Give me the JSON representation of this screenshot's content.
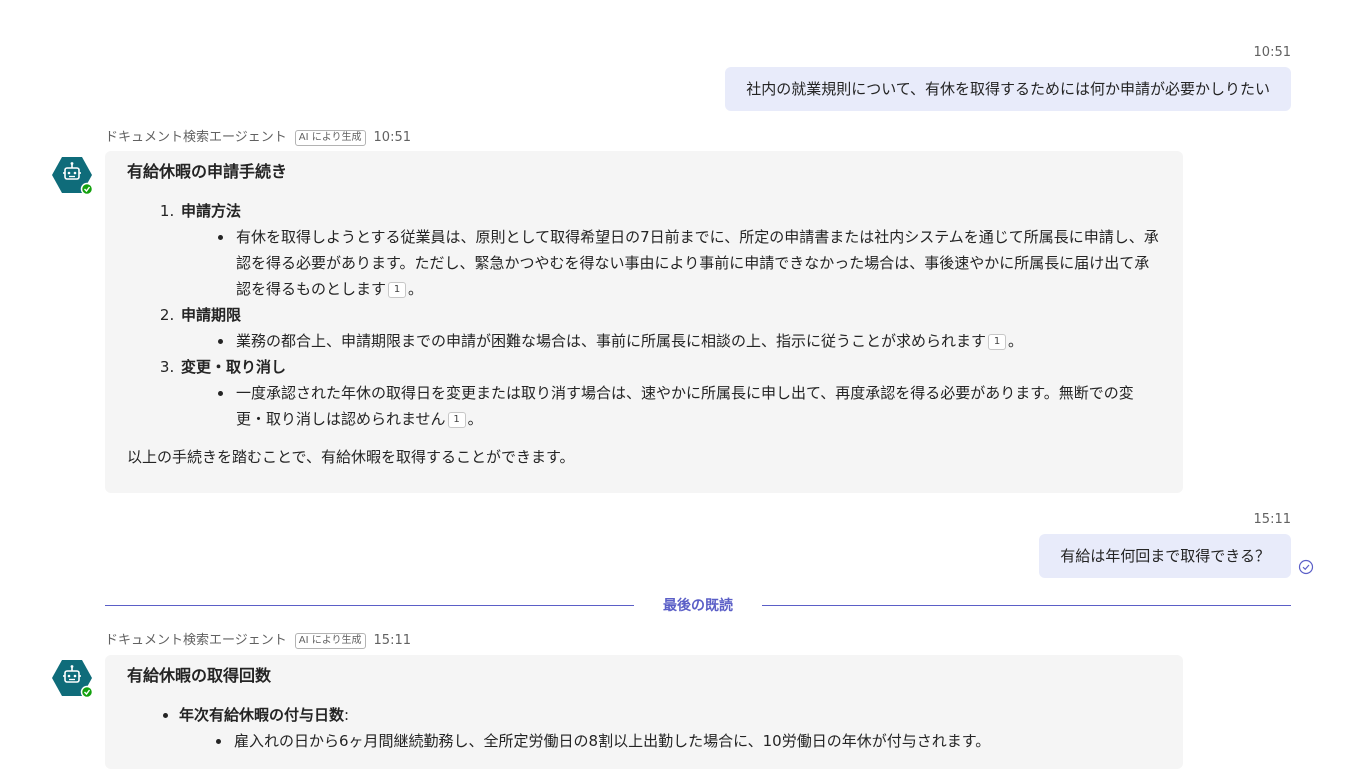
{
  "messages": {
    "m1": {
      "time": "10:51",
      "text": "社内の就業規則について、有休を取得するためには何か申請が必要かしりたい"
    },
    "r1": {
      "sender": "ドキュメント検索エージェント",
      "badge": "AI により生成",
      "time": "10:51",
      "title": "有給休暇の申請手続き",
      "steps": [
        {
          "label": "申請方法",
          "bullet_pre": "有休を取得しようとする従業員は、原則として取得希望日の7日前までに、所定の申請書または社内システムを通じて所属長に申請し、承認を得る必要があります。ただし、緊急かつやむを得ない事由により事前に申請できなかった場合は、事後速やかに所属長に届け出て承認を得るものとします",
          "cite": "1",
          "bullet_post": "。"
        },
        {
          "label": "申請期限",
          "bullet_pre": "業務の都合上、申請期限までの申請が困難な場合は、事前に所属長に相談の上、指示に従うことが求められます",
          "cite": "1",
          "bullet_post": "。"
        },
        {
          "label": "変更・取り消し",
          "bullet_pre": "一度承認された年休の取得日を変更または取り消す場合は、速やかに所属長に申し出て、再度承認を得る必要があります。無断での変更・取り消しは認められません",
          "cite": "1",
          "bullet_post": "。"
        }
      ],
      "closing": "以上の手続きを踏むことで、有給休暇を取得することができます。"
    },
    "m2": {
      "time": "15:11",
      "text": "有給は年何回まで取得できる？"
    },
    "divider": "最後の既読",
    "r2": {
      "sender": "ドキュメント検索エージェント",
      "badge": "AI により生成",
      "time": "15:11",
      "title": "有給休暇の取得回数",
      "item_label": "年次有給休暇の付与日数",
      "item_colon": ":",
      "sub_bullet": "雇入れの日から6ヶ月間継続勤務し、全所定労働日の8割以上出勤した場合に、10労働日の年休が付与されます。"
    }
  },
  "colors": {
    "user_bubble": "#e8ebfa",
    "bot_card": "#f5f5f5",
    "accent": "#5b5fc7",
    "avatar": "#0f6c7a",
    "status": "#13a10e"
  }
}
